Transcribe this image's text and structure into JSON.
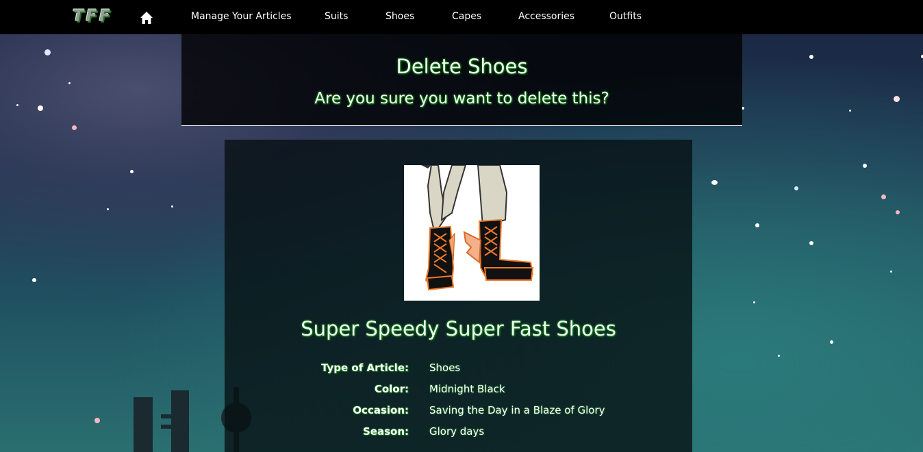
{
  "nav": {
    "brand": "TFF",
    "links": [
      "Manage Your Articles",
      "Suits",
      "Shoes",
      "Capes",
      "Accessories",
      "Outfits"
    ]
  },
  "header": {
    "title": "Delete Shoes",
    "subtitle": "Are you sure you want to delete this?"
  },
  "article": {
    "name": "Super Speedy Super Fast Shoes",
    "details": [
      {
        "label": "Type of Article:",
        "value": "Shoes"
      },
      {
        "label": "Color:",
        "value": "Midnight Black"
      },
      {
        "label": "Occasion:",
        "value": "Saving the Day in a Blaze of Glory"
      },
      {
        "label": "Season:",
        "value": "Glory days"
      }
    ]
  },
  "colors": {
    "nav_bg": "#000000",
    "heading_glow": "#2aa52a",
    "shoe_accent": "#f07a2a"
  }
}
